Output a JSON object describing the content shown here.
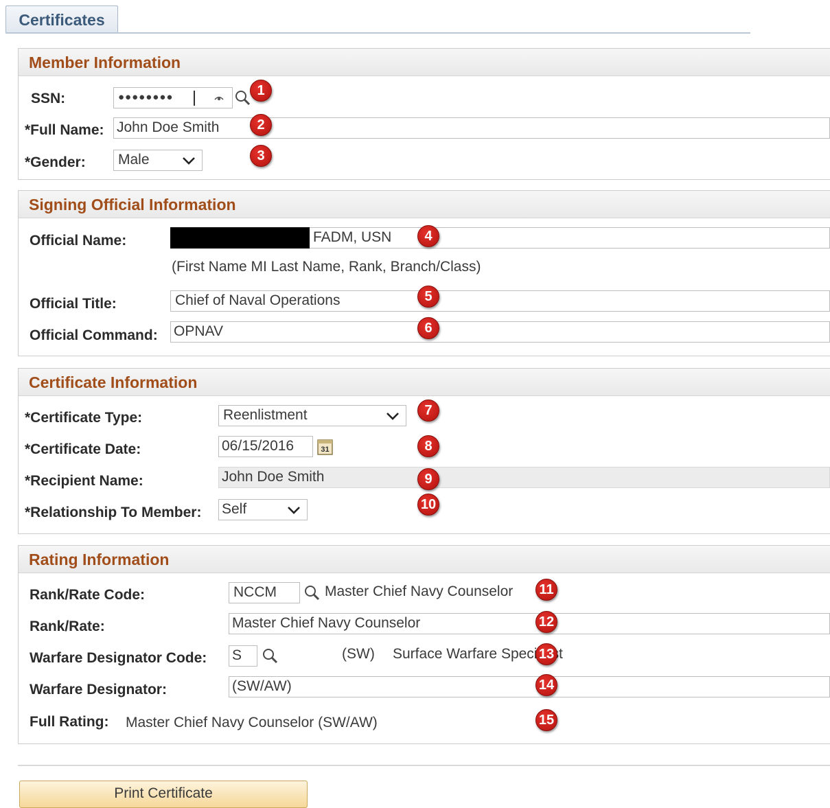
{
  "tab": {
    "label": "Certificates"
  },
  "member": {
    "header": "Member Information",
    "ssn_label": "SSN:",
    "ssn_value": "●●●●●●●●",
    "fullname_label": "*Full Name:",
    "fullname_value": "John Doe Smith",
    "gender_label": "*Gender:",
    "gender_value": "Male"
  },
  "official": {
    "header": "Signing Official Information",
    "name_label": "Official Name:",
    "name_value": "FADM, USN",
    "name_hint": "(First Name MI Last Name, Rank, Branch/Class)",
    "title_label": "Official Title:",
    "title_value": "Chief of Naval Operations",
    "command_label": "Official Command:",
    "command_value": "OPNAV"
  },
  "certificate": {
    "header": "Certificate Information",
    "type_label": "*Certificate Type:",
    "type_value": "Reenlistment",
    "date_label": "*Certificate Date:",
    "date_value": "06/15/2016",
    "calendar_icon_text": "31",
    "recipient_label": "*Recipient Name:",
    "recipient_value": "John Doe Smith",
    "relationship_label": "*Relationship To Member:",
    "relationship_value": "Self"
  },
  "rating": {
    "header": "Rating Information",
    "rankcode_label": "Rank/Rate Code:",
    "rankcode_value": "NCCM",
    "rankcode_desc": "Master Chief Navy Counselor",
    "rank_label": "Rank/Rate:",
    "rank_value": "Master Chief Navy Counselor",
    "warfarecode_label": "Warfare Designator Code:",
    "warfarecode_value": "S",
    "warfarecode_abbr": "(SW)",
    "warfarecode_desc": "Surface Warfare Specialist",
    "warfare_label": "Warfare Designator:",
    "warfare_value": "(SW/AW)",
    "fullrating_label": "Full Rating:",
    "fullrating_value": "Master Chief Navy Counselor (SW/AW)"
  },
  "buttons": {
    "print": "Print Certificate"
  },
  "badges": [
    "1",
    "2",
    "3",
    "4",
    "5",
    "6",
    "7",
    "8",
    "9",
    "10",
    "11",
    "12",
    "13",
    "14",
    "15"
  ],
  "colors": {
    "section_header_text": "#a14d1a",
    "badge": "#c4201b",
    "button": "#f6d899"
  },
  "icons": [
    "lookup-icon",
    "show-password-icon",
    "calendar-icon",
    "chevron-down-icon"
  ]
}
